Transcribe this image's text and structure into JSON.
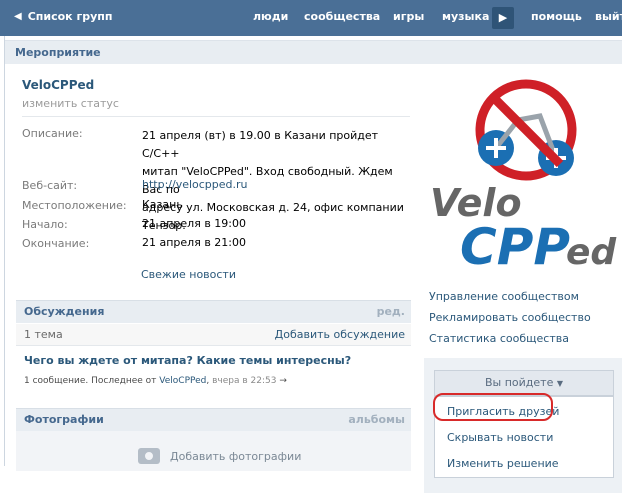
{
  "topbar": {
    "back_label": "Список групп",
    "nav": [
      "люди",
      "сообщества",
      "игры",
      "музыка",
      "помощь",
      "выйти"
    ]
  },
  "section_title": "Мероприятие",
  "group": {
    "name": "VeloCPPed",
    "change_status": "изменить статус"
  },
  "info": {
    "description_label": "Описание:",
    "description_lines": [
      "21 апреля (вт) в 19.00 в Казани пройдет C/C++",
      "митап \"VeloCPPed\". Вход свободный. Ждем Вас по",
      "адресу ул. Московская д. 24, офис компании Тензор."
    ],
    "website_label": "Веб-сайт:",
    "website_value": "http://velocpped.ru",
    "location_label": "Местоположение:",
    "location_value": "Казань",
    "start_label": "Начало:",
    "start_value": "21 апреля в 19:00",
    "end_label": "Окончание:",
    "end_value": "21 апреля в 21:00",
    "fresh_news": "Свежие новости"
  },
  "discussions": {
    "title": "Обсуждения",
    "edit": "ред.",
    "count": "1 тема",
    "add": "Добавить обсуждение",
    "topic_title": "Чего вы ждете от митапа? Какие темы интересны?",
    "topic_meta_prefix": "1 сообщение. Последнее от",
    "topic_author": "VeloCPPed",
    "topic_date": "вчера в 22:53",
    "topic_arrow": "→"
  },
  "photos": {
    "title": "Фотографии",
    "albums": "альбомы",
    "add_photo": "Добавить фотографии"
  },
  "logo": {
    "text_top": "Velo",
    "text_main": "CPP",
    "text_tail": "ed"
  },
  "side_links": [
    "Управление сообществом",
    "Рекламировать сообщество",
    "Статистика сообщества"
  ],
  "attend": {
    "button_label": "Вы пойдете",
    "menu": [
      "Пригласить друзей",
      "Скрывать новости",
      "Изменить решение"
    ]
  },
  "colors": {
    "topbar": "#4a6f96",
    "link": "#2b587a",
    "logo_blue": "#1b6fb3",
    "logo_gray": "#666666",
    "no_sign": "#cf2027",
    "highlight": "#d82a2a"
  }
}
